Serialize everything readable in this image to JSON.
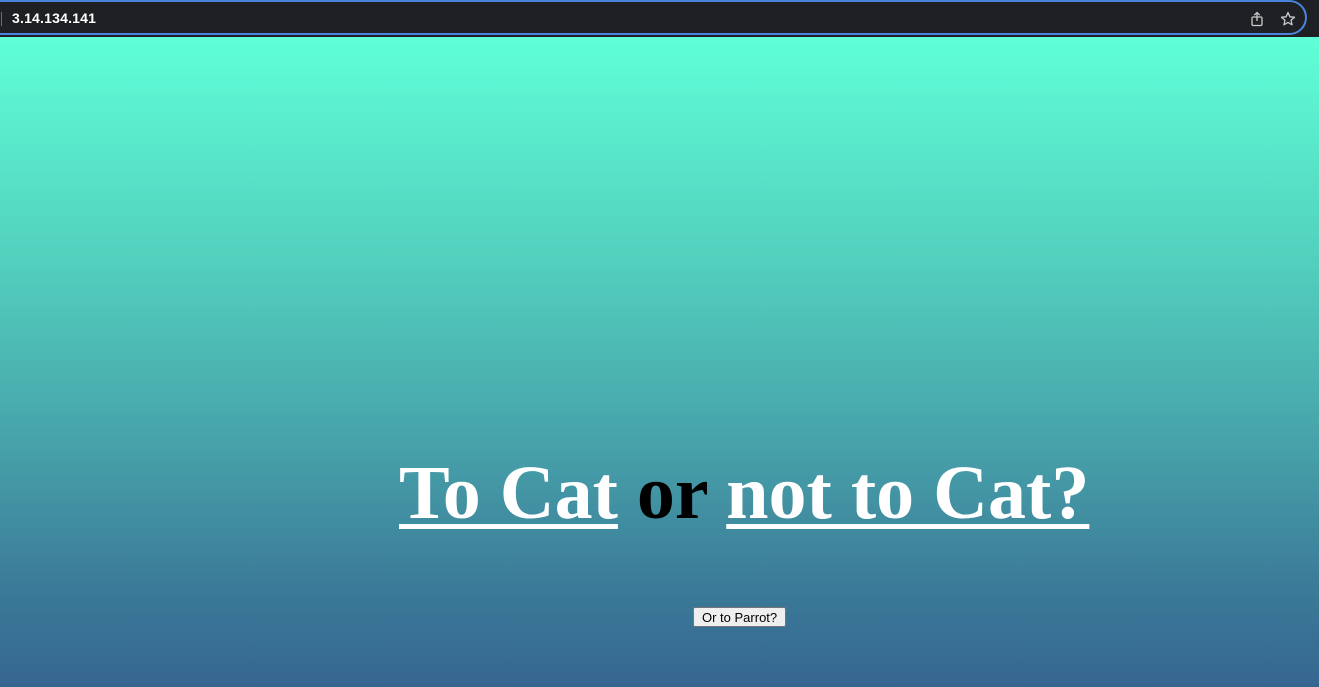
{
  "browser": {
    "url": "3.14.134.141",
    "icons": {
      "share": "share-icon",
      "bookmark": "star-icon"
    }
  },
  "page": {
    "heading": {
      "link1": "To Cat",
      "middle": "or",
      "link2": "not to Cat?"
    },
    "button_label": "Or to Parrot?",
    "colors": {
      "gradient_top": "#5fffd7",
      "gradient_bottom": "#366690",
      "link_color": "#ffffff",
      "text_color": "#000000"
    }
  }
}
